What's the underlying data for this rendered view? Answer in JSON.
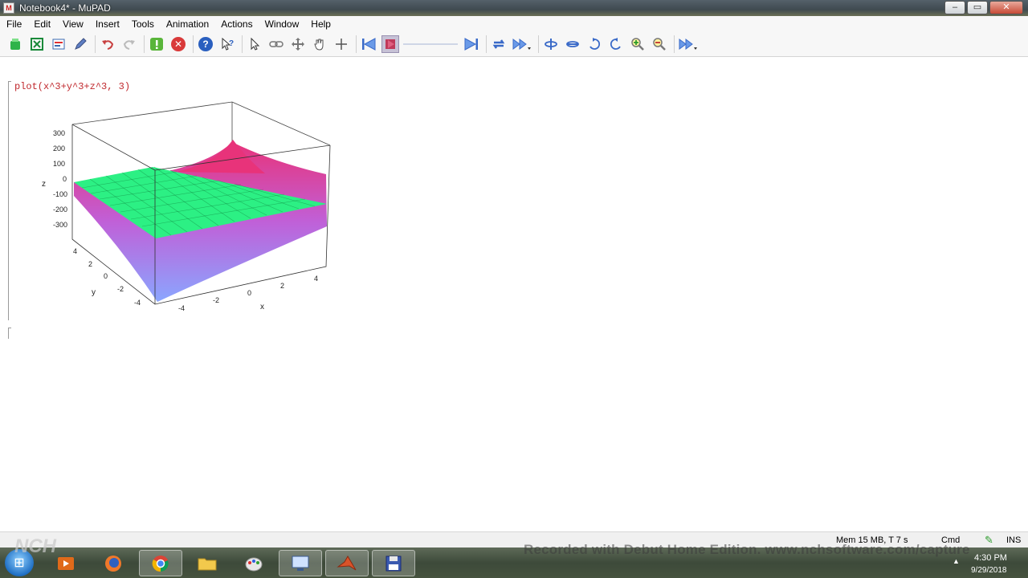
{
  "window": {
    "title": "Notebook4* - MuPAD",
    "app_icon": "M"
  },
  "window_buttons": {
    "minimize": "–",
    "maximize": "▭",
    "close": "✕"
  },
  "menu": [
    "File",
    "Edit",
    "View",
    "Insert",
    "Tools",
    "Animation",
    "Actions",
    "Window",
    "Help"
  ],
  "notebook": {
    "command": "plot(x^3+y^3+z^3, 3)",
    "plot": {
      "axis_x_label": "x",
      "axis_y_label": "y",
      "axis_z_label": "z",
      "z_ticks": [
        "300",
        "200",
        "100",
        "0",
        "-100",
        "-200",
        "-300"
      ],
      "x_ticks": [
        "-4",
        "-2",
        "0",
        "2",
        "4"
      ],
      "y_ticks": [
        "4",
        "2",
        "0",
        "-2",
        "-4"
      ],
      "colors": {
        "plane": "#2cf084",
        "surface_top": "#e8337a",
        "surface_mid": "#c060d8",
        "surface_low": "#8aa6ff"
      }
    }
  },
  "status": {
    "mem": "Mem 15 MB, T 7 s",
    "mode": "Cmd",
    "ins": "INS"
  },
  "watermark": "Recorded with Debut Home Edition. www.nchsoftware.com/capture",
  "watermark_logo": "NCH",
  "taskbar": {
    "clock_time": "4:30 PM",
    "clock_date": "9/29/2018"
  }
}
